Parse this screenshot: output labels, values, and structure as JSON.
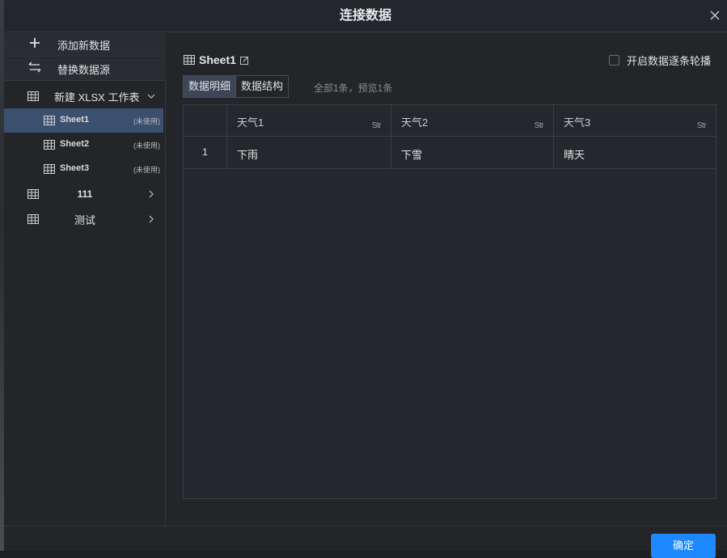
{
  "dialog": {
    "title": "连接数据"
  },
  "sidebar": {
    "add_label": "添加新数据",
    "replace_label": "替换数据源",
    "workbook_label": "新建 XLSX 工作表",
    "sheets": [
      {
        "name": "Sheet1",
        "tag": "(未使用)"
      },
      {
        "name": "Sheet2",
        "tag": "(未使用)"
      },
      {
        "name": "Sheet3",
        "tag": "(未使用)"
      }
    ],
    "sources": [
      {
        "label": "111"
      },
      {
        "label": "测试"
      }
    ]
  },
  "main": {
    "sheet_title": "Sheet1",
    "carousel_label": "开启数据逐条轮播",
    "tabs": [
      {
        "label": "数据明细"
      },
      {
        "label": "数据结构"
      }
    ],
    "count_text": "全部1条，预览1条",
    "table": {
      "columns": [
        {
          "name": "天气1",
          "type": "Str"
        },
        {
          "name": "天气2",
          "type": "Str"
        },
        {
          "name": "天气3",
          "type": "Str"
        }
      ],
      "rows": [
        {
          "index": "1",
          "cells": [
            "下雨",
            "下雪",
            "晴天"
          ]
        }
      ]
    }
  },
  "footer": {
    "ok_label": "确定"
  },
  "colors": {
    "accent": "#1e88ff",
    "selected_row": "#3b4f6e",
    "active_tab": "#3d4657"
  }
}
